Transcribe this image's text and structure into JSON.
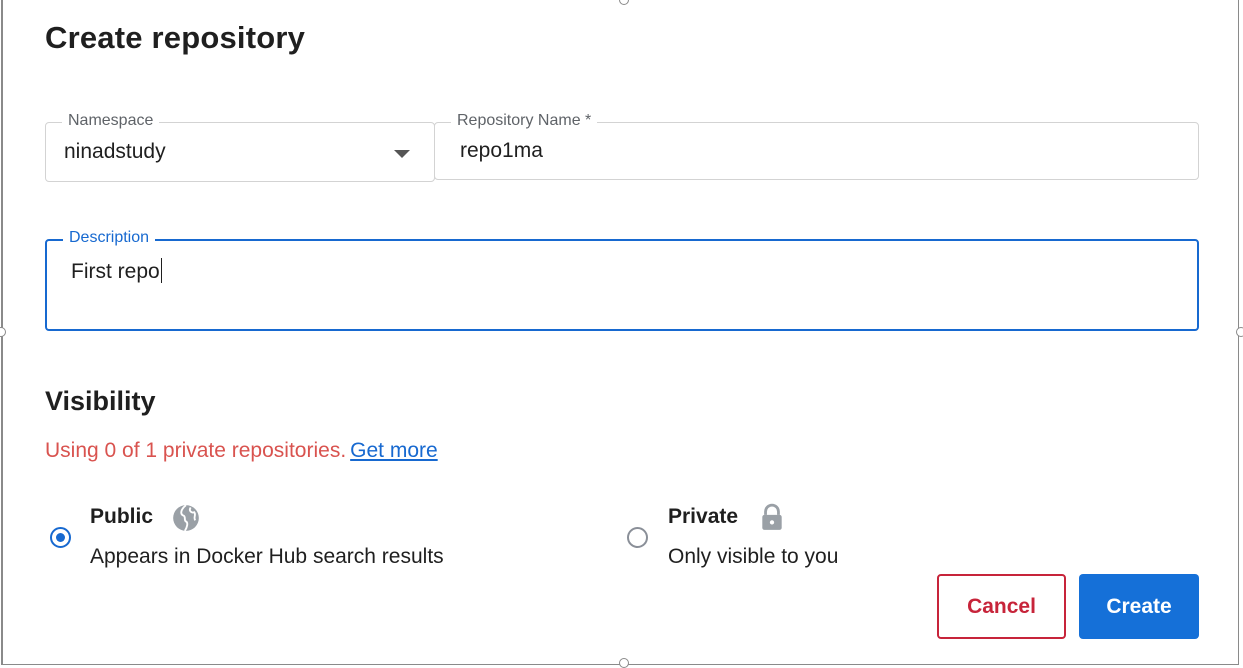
{
  "dialog": {
    "title": "Create repository"
  },
  "form": {
    "namespace": {
      "label": "Namespace",
      "value": "ninadstudy"
    },
    "repository_name": {
      "label": "Repository Name *",
      "value": "repo1ma"
    },
    "description": {
      "label": "Description",
      "value": "First repo"
    }
  },
  "visibility": {
    "heading": "Visibility",
    "usage_text": "Using 0 of 1 private repositories.",
    "get_more_link": "Get more",
    "options": [
      {
        "title": "Public",
        "description": "Appears in Docker Hub search results",
        "icon": "globe-icon",
        "selected": true
      },
      {
        "title": "Private",
        "description": "Only visible to you",
        "icon": "lock-icon",
        "selected": false
      }
    ]
  },
  "actions": {
    "cancel_label": "Cancel",
    "create_label": "Create"
  },
  "colors": {
    "primary": "#1570d8",
    "focus_border": "#1769d0",
    "danger": "#c7243a",
    "warning_text": "#d9534f"
  }
}
